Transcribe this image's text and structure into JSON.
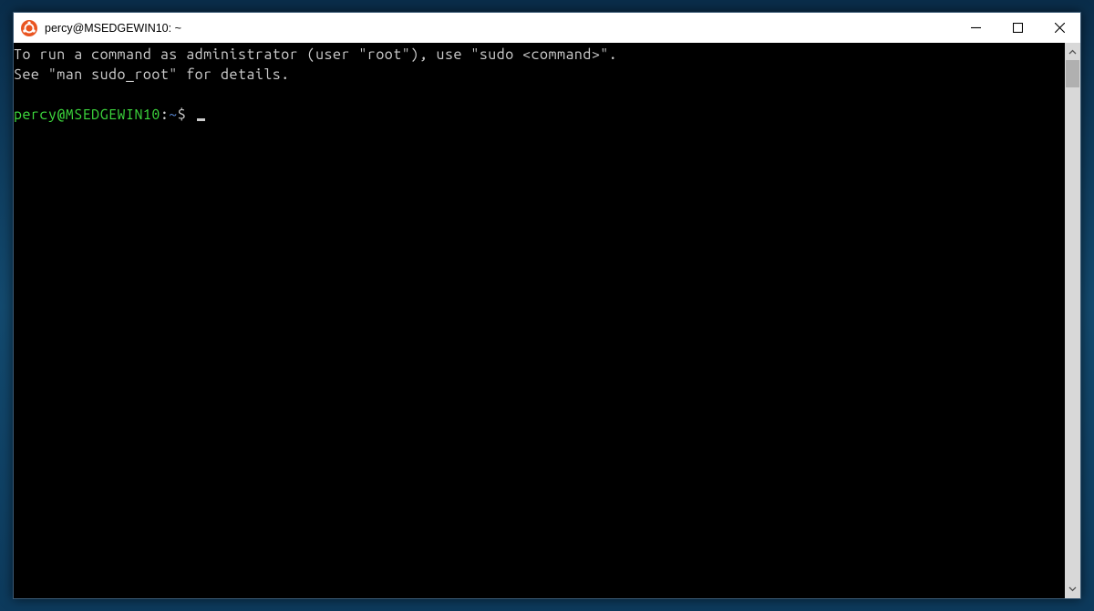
{
  "window": {
    "title": "percy@MSEDGEWIN10: ~",
    "icon_name": "ubuntu-icon"
  },
  "terminal": {
    "motd_line1": "To run a command as administrator (user \"root\"), use \"sudo <command>\".",
    "motd_line2": "See \"man sudo_root\" for details.",
    "prompt_user_host": "percy@MSEDGEWIN10",
    "prompt_colon": ":",
    "prompt_path": "~",
    "prompt_symbol": "$",
    "input_value": ""
  },
  "colors": {
    "prompt_user": "#3edb3e",
    "prompt_path": "#5a8ad6",
    "terminal_fg": "#cccccc",
    "terminal_bg": "#000000",
    "titlebar_bg": "#ffffff",
    "ubuntu_orange": "#e95420"
  }
}
